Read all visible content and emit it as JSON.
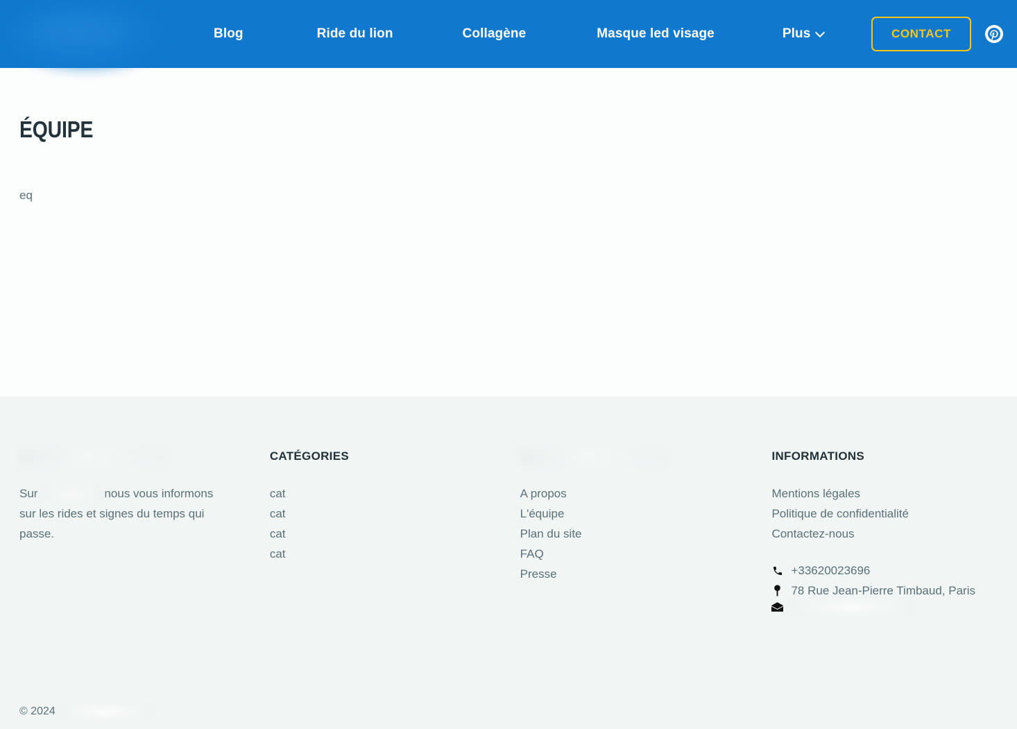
{
  "header": {
    "background_color": "#1079CE",
    "logo": {
      "name": "site-logo",
      "state": "blurred"
    },
    "nav": [
      {
        "label": "Blog",
        "has_dropdown": false
      },
      {
        "label": "Ride du lion",
        "has_dropdown": false
      },
      {
        "label": "Collagène",
        "has_dropdown": false
      },
      {
        "label": "Masque led visage",
        "has_dropdown": false
      },
      {
        "label": "Plus",
        "has_dropdown": true
      }
    ],
    "contact_button": {
      "label": "CONTACT",
      "border_color": "#F5C818",
      "text_color": "#F5C818"
    },
    "social": [
      {
        "name": "pinterest-icon",
        "label": "Pinterest"
      }
    ]
  },
  "main": {
    "title": "ÉQUIPE",
    "body": "eq"
  },
  "footer": {
    "background_color": "#F1F5F4",
    "about": {
      "heading": "",
      "text_before": "Sur",
      "text_after": "nous vous informons sur les rides et signes du temps qui passe."
    },
    "categories": {
      "heading": "CATÉGORIES",
      "items": [
        "cat",
        "cat",
        "cat",
        "cat"
      ]
    },
    "pages": {
      "heading": "",
      "items": [
        "A propos",
        "L'équipe",
        "Plan du site",
        "FAQ",
        "Presse"
      ]
    },
    "informations": {
      "heading": "INFORMATIONS",
      "items": [
        "Mentions légales",
        "Politique de confidentialité",
        "Contactez-nous"
      ],
      "contact": {
        "phone": "+33620023696",
        "address": "78 Rue Jean-Pierre Timbaud, Paris",
        "email": ""
      }
    },
    "copyright": "© 2024"
  }
}
